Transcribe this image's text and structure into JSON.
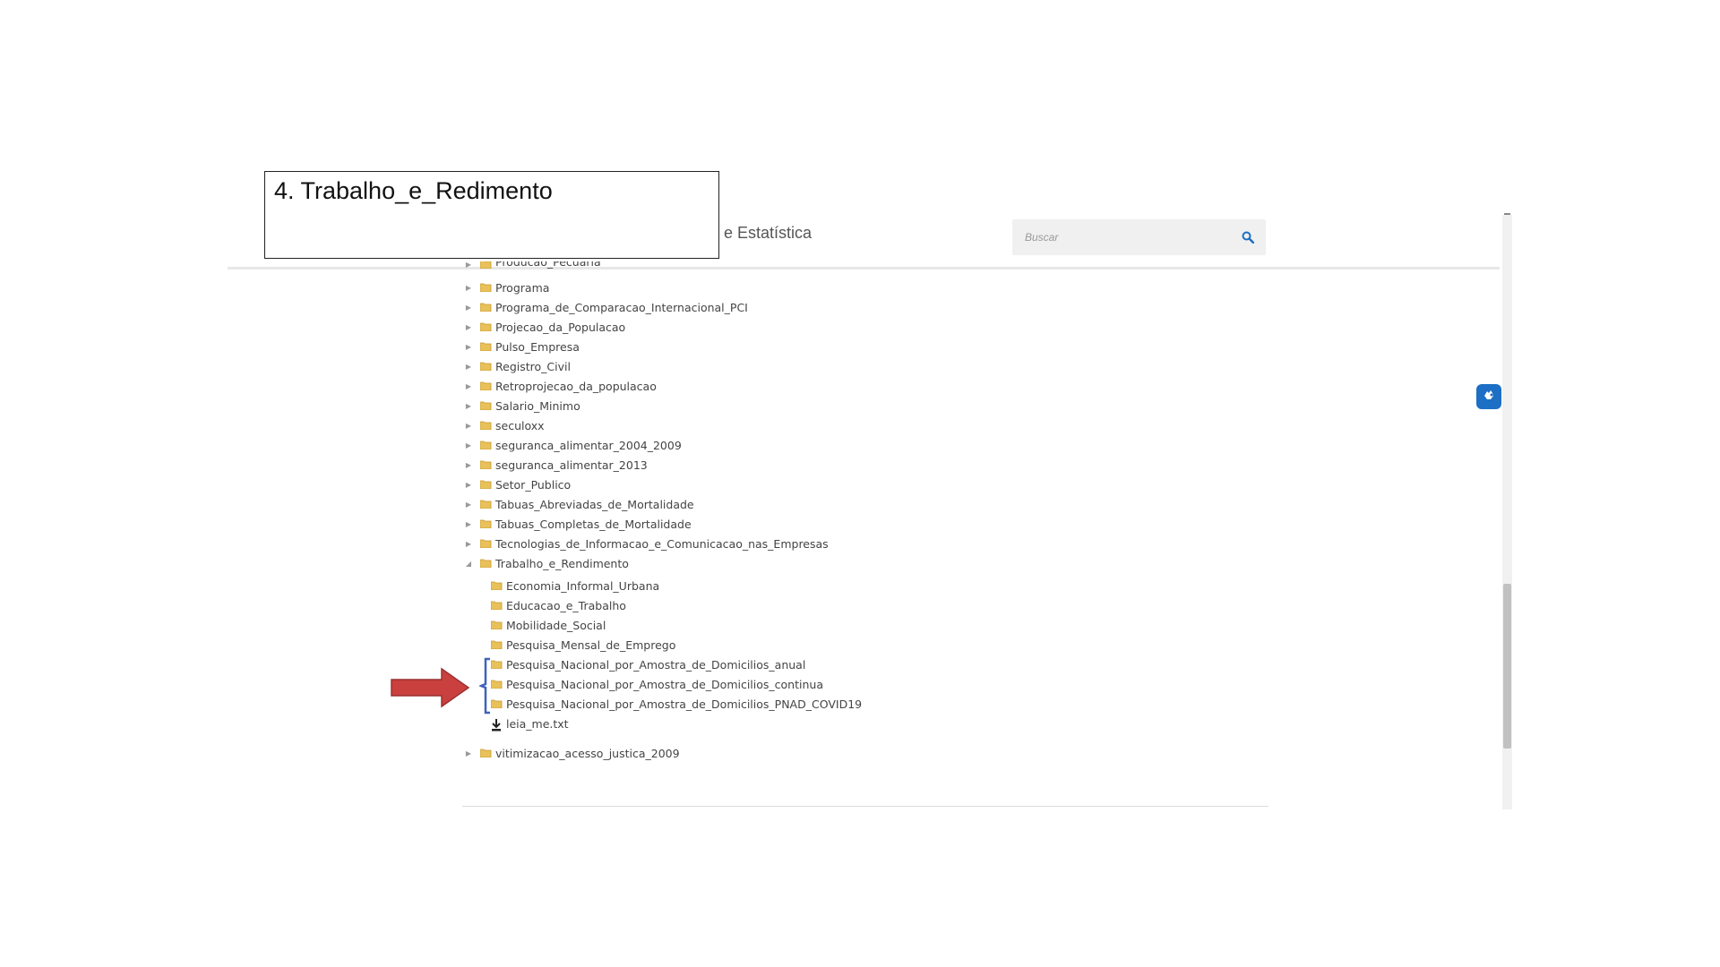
{
  "annotation": {
    "title": "4. Trabalho_e_Redimento"
  },
  "header": {
    "site_title_fragment": "e Estatística",
    "search": {
      "placeholder": "Buscar"
    }
  },
  "tree": {
    "partial_top_item": "Producao_Pecuaria",
    "items": [
      {
        "label": "Programa",
        "expanded": false
      },
      {
        "label": "Programa_de_Comparacao_Internacional_PCI",
        "expanded": false
      },
      {
        "label": "Projecao_da_Populacao",
        "expanded": false
      },
      {
        "label": "Pulso_Empresa",
        "expanded": false
      },
      {
        "label": "Registro_Civil",
        "expanded": false
      },
      {
        "label": "Retroprojecao_da_populacao",
        "expanded": false
      },
      {
        "label": "Salario_Minimo",
        "expanded": false
      },
      {
        "label": "seculoxx",
        "expanded": false
      },
      {
        "label": "seguranca_alimentar_2004_2009",
        "expanded": false
      },
      {
        "label": "seguranca_alimentar_2013",
        "expanded": false
      },
      {
        "label": "Setor_Publico",
        "expanded": false
      },
      {
        "label": "Tabuas_Abreviadas_de_Mortalidade",
        "expanded": false
      },
      {
        "label": "Tabuas_Completas_de_Mortalidade",
        "expanded": false
      },
      {
        "label": "Tecnologias_de_Informacao_e_Comunicacao_nas_Empresas",
        "expanded": false
      },
      {
        "label": "Trabalho_e_Rendimento",
        "expanded": true
      }
    ],
    "children": [
      {
        "label": "Economia_Informal_Urbana",
        "type": "folder"
      },
      {
        "label": "Educacao_e_Trabalho",
        "type": "folder"
      },
      {
        "label": "Mobilidade_Social",
        "type": "folder"
      },
      {
        "label": "Pesquisa_Mensal_de_Emprego",
        "type": "folder"
      },
      {
        "label": "Pesquisa_Nacional_por_Amostra_de_Domicilios_anual",
        "type": "folder",
        "highlighted": true
      },
      {
        "label": "Pesquisa_Nacional_por_Amostra_de_Domicilios_continua",
        "type": "folder",
        "highlighted": true
      },
      {
        "label": "Pesquisa_Nacional_por_Amostra_de_Domicilios_PNAD_COVID19",
        "type": "folder",
        "highlighted": true
      },
      {
        "label": "leia_me.txt",
        "type": "file"
      }
    ],
    "after": [
      {
        "label": "vitimizacao_acesso_justica_2009",
        "expanded": false
      }
    ]
  },
  "icons": {
    "folder": "folder-icon",
    "file": "download-icon",
    "search": "search-icon",
    "accessibility": "hand-sign-icon",
    "pointer": "red-arrow-icon"
  },
  "colors": {
    "link_blue": "#1c6fc4",
    "folder_yellow": "#e8c15a",
    "arrow_red": "#c9403f",
    "bracket_blue": "#3f63b8"
  }
}
